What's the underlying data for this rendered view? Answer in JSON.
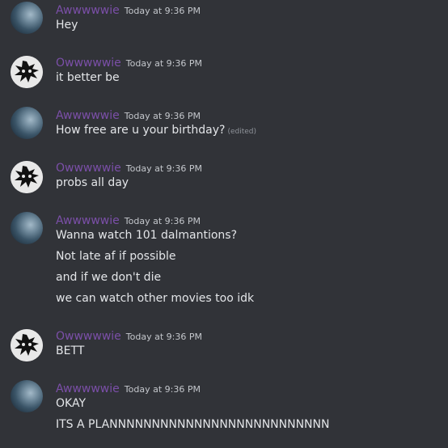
{
  "messages": [
    {
      "author": "Awwwwwie",
      "avatar": "blue-blur-avatar",
      "time": "Today at 9:36 PM",
      "lines": [
        "Hey"
      ]
    },
    {
      "author": "Owwwwwie",
      "avatar": "black-cat-avatar",
      "time": "Today at 9:36 PM",
      "lines": [
        "it better be"
      ]
    },
    {
      "author": "Awwwwwie",
      "avatar": "blue-blur-avatar",
      "time": "Today at 9:36 PM",
      "lines": [
        "How free are u your birthday?"
      ],
      "edited": "(edited)"
    },
    {
      "author": "Owwwwwie",
      "avatar": "black-cat-avatar",
      "time": "Today at 9:36 PM",
      "lines": [
        "probs all day"
      ]
    },
    {
      "author": "Awwwwwie",
      "avatar": "blue-blur-avatar",
      "time": "Today at 9:36 PM",
      "lines": [
        "Wanna watch 101 dalmantions?",
        "Not late af if possible",
        "and if we don't die",
        "we can watch other movies too idk"
      ]
    },
    {
      "author": "Owwwwwie",
      "avatar": "black-cat-avatar",
      "time": "Today at 9:36 PM",
      "lines": [
        "BETT"
      ]
    },
    {
      "author": "Awwwwwie",
      "avatar": "blue-blur-avatar",
      "time": "Today at 9:36 PM",
      "lines": [
        "OKAY",
        "ITS A PLANNNNNNNNNNNNNNNNNNNNNNNNNN"
      ]
    }
  ],
  "colors": {
    "background": "#313338",
    "username": "#7b4fa8",
    "message_text": "#e3e5e8",
    "timestamp": "#c4c7cc"
  }
}
